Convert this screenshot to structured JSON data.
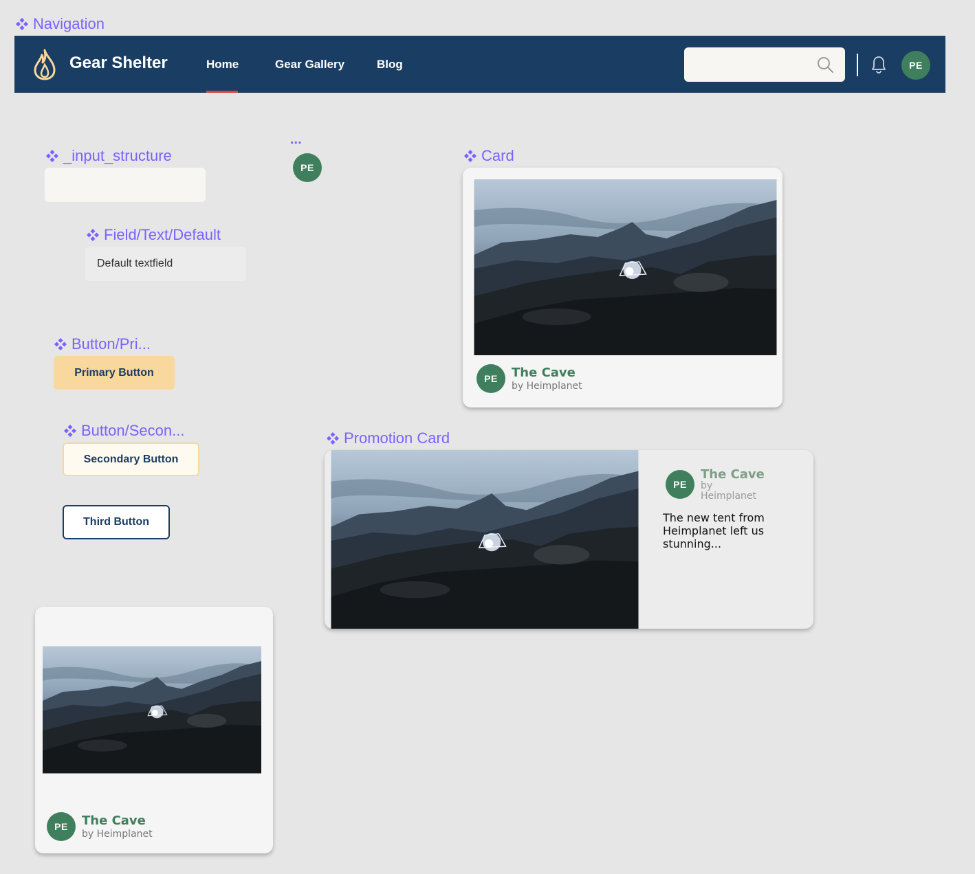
{
  "labels": {
    "navigation": "Navigation",
    "input_structure": "_input_structure",
    "field_text_default": "Field/Text/Default",
    "button_primary": "Button/Pri...",
    "button_secondary": "Button/Secon...",
    "card": "Card",
    "promotion_card": "Promotion Card",
    "ellipsis": "..."
  },
  "nav": {
    "brand": "Gear Shelter",
    "links": [
      "Home",
      "Gear Gallery",
      "Blog"
    ],
    "active_link": "Home",
    "search_value": "",
    "avatar_initials": "PE",
    "icons": [
      "flame-logo-icon",
      "search-icon",
      "bell-icon"
    ]
  },
  "avatar_standalone": "PE",
  "textfield": {
    "value": "Default textfield"
  },
  "buttons": {
    "primary": "Primary Button",
    "secondary": "Secondary Button",
    "third": "Third Button"
  },
  "card": {
    "avatar": "PE",
    "title": "The Cave",
    "subtitle": "by Heimplanet"
  },
  "promo": {
    "avatar": "PE",
    "title": "The Cave",
    "by": "by",
    "maker": "Heimplanet",
    "description": "The new tent from Heimplanet left us stunning..."
  },
  "card_small": {
    "avatar": "PE",
    "title": "The Cave",
    "subtitle": "by Heimplanet"
  },
  "colors": {
    "nav_bg": "#1a3d63",
    "accent_purple": "#7b61ff",
    "avatar_green": "#3f7f5d",
    "primary_button": "#f8d89c",
    "active_underline": "#d64545"
  }
}
